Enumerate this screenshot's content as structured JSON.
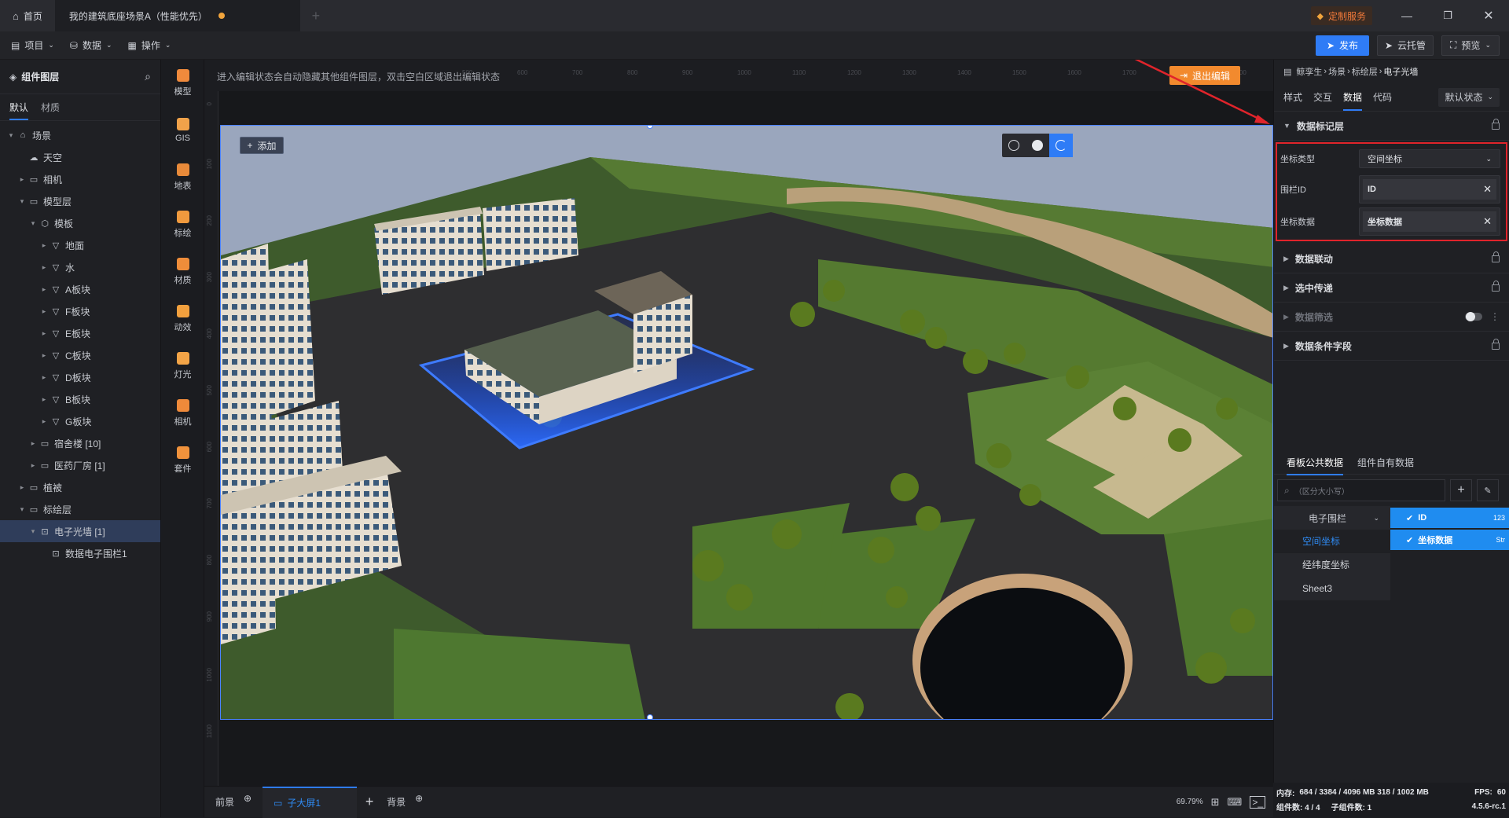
{
  "titlebar": {
    "home_label": "首页",
    "doc_tab": "我的建筑底座场景A（性能优先）",
    "custom_service": "定制服务"
  },
  "toolbar": {
    "project": "项目",
    "data": "数据",
    "operate": "操作",
    "publish": "发布",
    "cloud": "云托管",
    "preview": "预览"
  },
  "left": {
    "title": "组件图层",
    "tabs": [
      "默认",
      "材质"
    ],
    "tree": [
      {
        "label": "场景",
        "level": 0,
        "caret": "▾",
        "icon": "⌂"
      },
      {
        "label": "天空",
        "level": 1,
        "caret": "",
        "icon": "☁"
      },
      {
        "label": "相机",
        "level": 1,
        "caret": "▸",
        "icon": "▭"
      },
      {
        "label": "模型层",
        "level": 1,
        "caret": "▾",
        "icon": "▭"
      },
      {
        "label": "模板",
        "level": 2,
        "caret": "▾",
        "icon": "⬡"
      },
      {
        "label": "地面",
        "level": 3,
        "caret": "▸",
        "icon": "▽"
      },
      {
        "label": "水",
        "level": 3,
        "caret": "▸",
        "icon": "▽"
      },
      {
        "label": "A板块",
        "level": 3,
        "caret": "▸",
        "icon": "▽"
      },
      {
        "label": "F板块",
        "level": 3,
        "caret": "▸",
        "icon": "▽"
      },
      {
        "label": "E板块",
        "level": 3,
        "caret": "▸",
        "icon": "▽"
      },
      {
        "label": "C板块",
        "level": 3,
        "caret": "▸",
        "icon": "▽"
      },
      {
        "label": "D板块",
        "level": 3,
        "caret": "▸",
        "icon": "▽"
      },
      {
        "label": "B板块",
        "level": 3,
        "caret": "▸",
        "icon": "▽"
      },
      {
        "label": "G板块",
        "level": 3,
        "caret": "▸",
        "icon": "▽"
      },
      {
        "label": "宿舍楼 [10]",
        "level": 2,
        "caret": "▸",
        "icon": "▭"
      },
      {
        "label": "医药厂房 [1]",
        "level": 2,
        "caret": "▸",
        "icon": "▭"
      },
      {
        "label": "植被",
        "level": 1,
        "caret": "▸",
        "icon": "▭"
      },
      {
        "label": "标绘层",
        "level": 1,
        "caret": "▾",
        "icon": "▭"
      },
      {
        "label": "电子光墙 [1]",
        "level": 2,
        "caret": "▾",
        "icon": "⊡",
        "selected": true
      },
      {
        "label": "数据电子围栏1",
        "level": 3,
        "caret": "",
        "icon": "⊡"
      }
    ]
  },
  "rail": [
    {
      "label": "模型",
      "color": "#f08a3c"
    },
    {
      "label": "GIS",
      "color": "#f0a24a"
    },
    {
      "label": "地表",
      "color": "#e88a3a"
    },
    {
      "label": "标绘",
      "color": "#f09a3e"
    },
    {
      "label": "材质",
      "color": "#ef8d3a"
    },
    {
      "label": "动效",
      "color": "#f2a03e"
    },
    {
      "label": "灯光",
      "color": "#f3a447"
    },
    {
      "label": "相机",
      "color": "#ef8a3a"
    },
    {
      "label": "套件",
      "color": "#f0923c"
    }
  ],
  "canvas": {
    "hint": "进入编辑状态会自动隐藏其他组件图层，双击空白区域退出编辑状态",
    "exit_edit": "退出编辑",
    "add": "添加",
    "ruler_top": [
      "500",
      "600",
      "700",
      "800",
      "900",
      "1000",
      "1100",
      "1200",
      "1300",
      "1400",
      "1500",
      "1600",
      "1700",
      "1800",
      "1900"
    ],
    "ruler_left": [
      "0",
      "100",
      "200",
      "300",
      "400",
      "500",
      "600",
      "700",
      "800",
      "900",
      "1000",
      "1100"
    ]
  },
  "right": {
    "breadcrumb": [
      "鲸孪生",
      "场景",
      "标绘层",
      "电子光墙"
    ],
    "tabs": [
      "样式",
      "交互",
      "数据",
      "代码"
    ],
    "state": "默认状态",
    "sections": {
      "data_marker": "数据标记层",
      "data_link": "数据联动",
      "select_pass": "选中传递",
      "data_filter": "数据筛选",
      "data_condition": "数据条件字段"
    },
    "form": {
      "coord_type_label": "坐标类型",
      "coord_type_value": "空间坐标",
      "fence_id_label": "围栏ID",
      "fence_id_value": "ID",
      "coord_data_label": "坐标数据",
      "coord_data_value": "坐标数据"
    },
    "data_tabs": [
      "看板公共数据",
      "组件自有数据"
    ],
    "search_placeholder": "（区分大小写）",
    "dataset": "电子围栏",
    "sheets": [
      "空间坐标",
      "经纬度坐标",
      "Sheet3"
    ],
    "fields": [
      {
        "name": "ID",
        "type": "123"
      },
      {
        "name": "坐标数据",
        "type": "Str"
      }
    ],
    "highlight_color": "#e0242b"
  },
  "bottom": {
    "front": "前景",
    "screen_tab": "子大屏1",
    "background": "背景",
    "zoom": "69.79%"
  },
  "status": {
    "memory": "内存:",
    "mem_values": "684 / 3384 / 4096 MB  318 / 1002 MB",
    "fps_label": "FPS:",
    "fps": "60",
    "components": "组件数: 4 / 4",
    "sub_components": "子组件数: 1",
    "version": "4.5.6-rc.1"
  }
}
